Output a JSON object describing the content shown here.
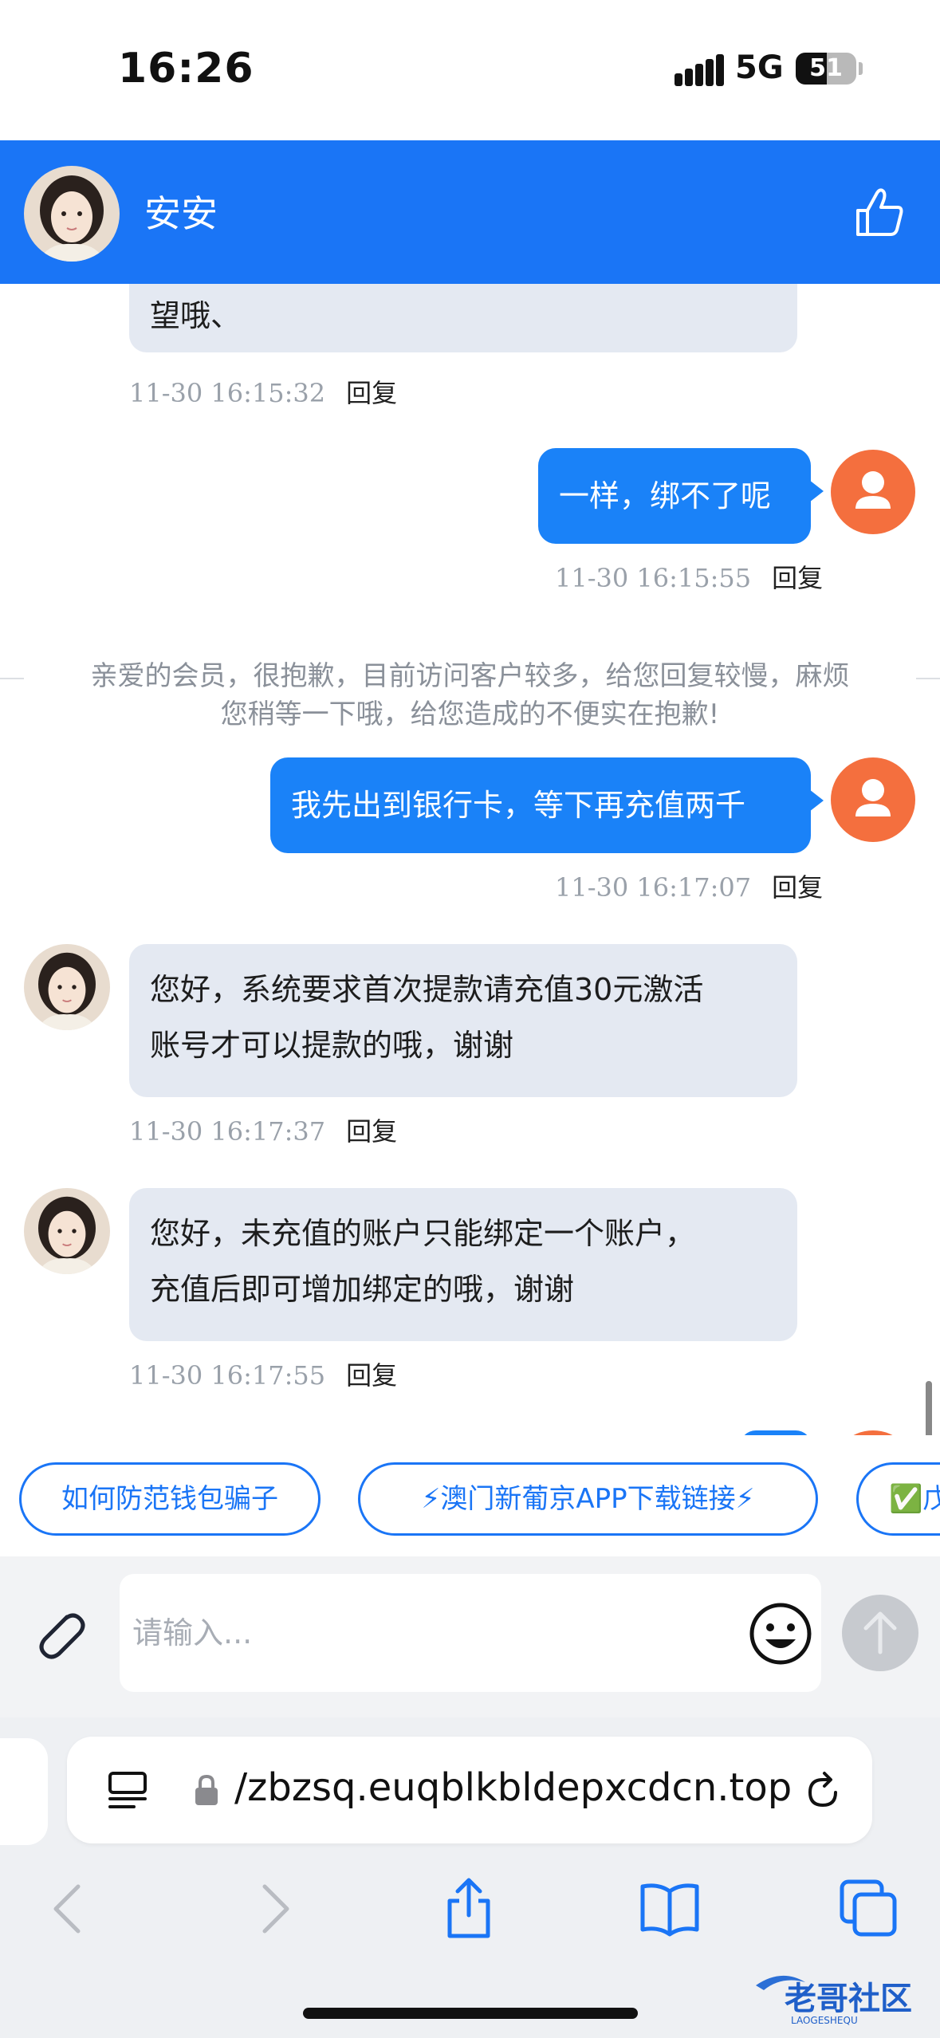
{
  "status_bar": {
    "time": "16:26",
    "network": "5G",
    "battery": "51",
    "battery_level": 0.51
  },
  "header": {
    "contact_name": "安安"
  },
  "messages": [
    {
      "side": "in",
      "text": "望哦、",
      "time": "11-30 16:15:32",
      "reply": "回复"
    },
    {
      "side": "out",
      "text": "一样，绑不了呢",
      "time": "11-30 16:15:55",
      "reply": "回复"
    },
    {
      "side": "system",
      "lines": [
        "亲爱的会员，很抱歉，目前访问客户较多，给您回复较慢，麻烦",
        "您稍等一下哦，给您造成的不便实在抱歉!"
      ]
    },
    {
      "side": "out",
      "text": "我先出到银行卡，等下再充值两千",
      "time": "11-30 16:17:07",
      "reply": "回复"
    },
    {
      "side": "in",
      "lines": [
        "您好，系统要求首次提款请充值30元激活",
        "账号才可以提款的哦，谢谢"
      ],
      "time": "11-30 16:17:37",
      "reply": "回复"
    },
    {
      "side": "in",
      "lines": [
        "您好，未充值的账户只能绑定一个账户，",
        "充值后即可增加绑定的哦，谢谢"
      ],
      "time": "11-30 16:17:55",
      "reply": "回复"
    }
  ],
  "quick_replies": [
    "如何防范钱包骗子",
    "⚡澳门新葡京APP下载链接⚡",
    "✅戊"
  ],
  "composer": {
    "placeholder": "请输入..."
  },
  "browser": {
    "url": "/zbzsq.euqblkbldepxcdcn.top"
  },
  "watermark": {
    "title": "老哥社区",
    "subtitle": "LAOGESHEQU"
  },
  "icons": [
    "like-icon",
    "attach-icon",
    "emoji-icon",
    "send-icon",
    "reader-icon",
    "lock-icon",
    "reload-icon",
    "back-icon",
    "forward-icon",
    "share-icon",
    "bookmarks-icon",
    "tabs-icon"
  ],
  "colors": {
    "brand_blue": "#1a75f6",
    "user_bubble": "#1a82f8",
    "agent_bubble": "#e4e9f2",
    "user_avatar": "#f46f3e"
  }
}
